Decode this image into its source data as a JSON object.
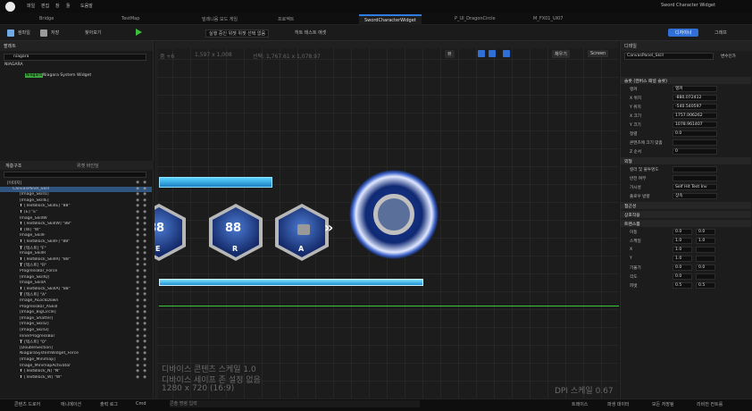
{
  "titlebar": {
    "menus": [
      "파일",
      "편집",
      "창",
      "툴",
      "도움말"
    ],
    "right_title": "Sword Character Widget"
  },
  "tabs": [
    "Bridge",
    "TestMap",
    "밀레니움 모드 게임",
    "프로젝트",
    "SwordCharacterWidget",
    "P_UI_DragonCircle",
    "M_FX01_UI07"
  ],
  "toolbar": {
    "items": [
      "컴파일",
      "저장",
      "찾아보기",
      "플레이",
      "실행 중인 위젯 위젯 선택 없음",
      "히트 테스트 애셋"
    ],
    "designer": "디자이너",
    "graph": "그래프"
  },
  "palette": {
    "title": "팔레트",
    "search_placeholder": "niagara",
    "category": "NIAGARA",
    "item": "Niagara System Widget"
  },
  "hierarchy": {
    "tabs": [
      "계층구조",
      "위젯 바인딩"
    ],
    "rows": [
      {
        "t": "",
        "l": "[이미지]"
      },
      {
        "t": "",
        "l": "CanvasPanel_Skill",
        "sel": true
      },
      {
        "t": "",
        "l": "[Image_Skill1]"
      },
      {
        "t": "",
        "l": "[Image_SkillE]"
      },
      {
        "t": "T",
        "l": "[TextBlock_SkillE] \"88\""
      },
      {
        "t": "T",
        "l": "[E] \"E\""
      },
      {
        "t": "",
        "l": "Image_SkillW"
      },
      {
        "t": "T",
        "l": "[TextBlock_SkillW] \"88\""
      },
      {
        "t": "T",
        "l": "[W] \"W\""
      },
      {
        "t": "",
        "l": "Image_SkillF"
      },
      {
        "t": "T",
        "l": "[TextBlock_SkillF] \"88\""
      },
      {
        "t": "T",
        "l": "[텍스트] \"F\""
      },
      {
        "t": "",
        "l": "Image_SkillR"
      },
      {
        "t": "T",
        "l": "[TextBlock_SkillR] \"88\""
      },
      {
        "t": "T",
        "l": "[텍스트] \"R\""
      },
      {
        "t": "",
        "l": "ProgressBar_Force"
      },
      {
        "t": "",
        "l": "[Image_SkillQ]"
      },
      {
        "t": "",
        "l": "Image_SkillA"
      },
      {
        "t": "T",
        "l": "[TextBlock_SkillA] \"88\""
      },
      {
        "t": "T",
        "l": "[텍스트] \"A\""
      },
      {
        "t": "",
        "l": "Image_ALockDown"
      },
      {
        "t": "",
        "l": "ProgressBar_ASkill"
      },
      {
        "t": "",
        "l": "[Image_BigCircle]"
      },
      {
        "t": "",
        "l": "[Image_Shatter]"
      },
      {
        "t": "",
        "l": "[Image_Skill2]"
      },
      {
        "t": "",
        "l": "[Image_Skill3]"
      },
      {
        "t": "",
        "l": "InnerProgressBar"
      },
      {
        "t": "T",
        "l": "[텍스트] \"0\""
      },
      {
        "t": "",
        "l": "[DoubleSection]"
      },
      {
        "t": "",
        "l": "NiagaraSystemWidget_Force"
      },
      {
        "t": "",
        "l": "[Image_Minimap]"
      },
      {
        "t": "",
        "l": "Image_MinimapActivator"
      },
      {
        "t": "T",
        "l": "[TextBlock_N] \"N\""
      },
      {
        "t": "T",
        "l": "[TextBlock_W] \"W\""
      }
    ]
  },
  "viewport": {
    "zoom": "줌 +6",
    "resolution": "1,597 x 1,008",
    "selection": "선택: 1,767.61 x 1,078.97",
    "screen_size": "Screen",
    "view_btn": "뷰",
    "fill_screen": "채우기",
    "scale_line1": "디바이스 콘텐츠 스케일 1.0",
    "scale_line2": "디바이스 세이프 존 설정 없음",
    "res_line": "1280 x 720 (16:9)",
    "dpi": "DPI 스케일 0.67",
    "skills": [
      {
        "num": "88",
        "key": "E"
      },
      {
        "num": "88",
        "key": "R"
      },
      {
        "num": "",
        "key": "A"
      }
    ]
  },
  "details": {
    "title": "디테일",
    "name_field": "CanvasPanel_Skill",
    "var_label": "변수인가",
    "sections": [
      "슬롯 (캔버스 패널 슬롯)",
      "외형",
      "접근성",
      "상호작용",
      "트랜스폼"
    ],
    "props": [
      {
        "l": "앵커",
        "v": "앵커"
      },
      {
        "l": "X 위치",
        "v": "-880.072412"
      },
      {
        "l": "Y 위치",
        "v": "-540.540597"
      },
      {
        "l": "X 크기",
        "v": "1757.006262"
      },
      {
        "l": "Y 크기",
        "v": "1078.961407"
      },
      {
        "l": "정렬",
        "v": "0.0"
      },
      {
        "l": "콘텐츠에 크기 맞춤",
        "v": ""
      },
      {
        "l": "Z 순서",
        "v": "0"
      }
    ],
    "props2": [
      {
        "l": "컬러 및 불투명도",
        "v": ""
      },
      {
        "l": "반전 여부",
        "v": ""
      },
      {
        "l": "가시성",
        "v": "Self Hit Test Inv"
      },
      {
        "l": "플로우 방향",
        "v": "상속"
      }
    ],
    "transform": [
      {
        "l": "이동",
        "a": "0.0",
        "b": "0.0"
      },
      {
        "l": "스케일",
        "a": "1.0",
        "b": "1.0"
      },
      {
        "l": "X",
        "a": "1.0",
        "b": ""
      },
      {
        "l": "Y",
        "a": "1.0",
        "b": ""
      },
      {
        "l": "기울기",
        "a": "0.0",
        "b": "0.0"
      },
      {
        "l": "각도",
        "a": "0.0",
        "b": ""
      },
      {
        "l": "피벗",
        "a": "0.5",
        "b": "0.5"
      }
    ]
  },
  "status": {
    "items": [
      "콘텐츠 드로어",
      "애니메이션",
      "출력 로그",
      "Cmd",
      "콘솔 명령 입력"
    ],
    "right": [
      "트레이스",
      "파생 데이터",
      "모든 저장됨",
      "리비전 컨트롤"
    ]
  }
}
